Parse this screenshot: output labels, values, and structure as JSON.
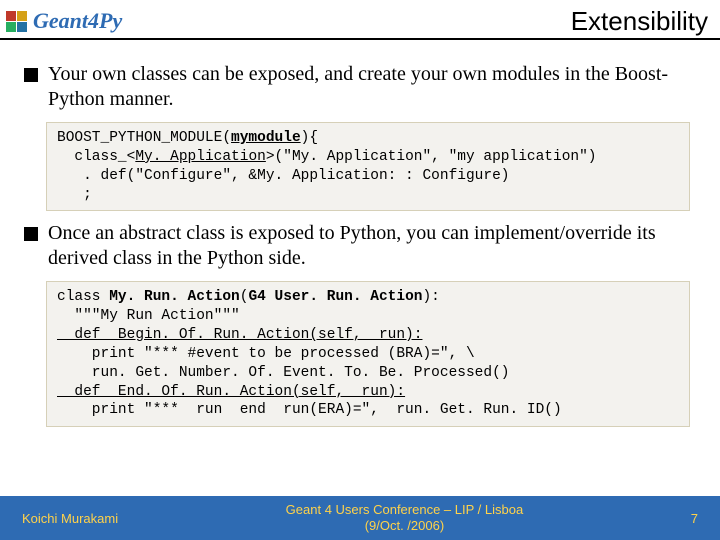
{
  "brand": "Geant4Py",
  "title": "Extensibility",
  "bullets": [
    "Your own classes can be exposed, and create your own modules in the Boost-Python manner.",
    "Once an abstract class is exposed to Python, you can implement/override its derived class in the Python side."
  ],
  "code1": {
    "l1a": "BOOST_PYTHON_MODULE(",
    "l1b": "mymodule",
    "l1c": "){",
    "l2a": "  class_<",
    "l2b": "My. Application",
    "l2c": ">(\"My. Application\", \"my application\")",
    "l3": "   . def(\"Configure\", &My. Application: : Configure)",
    "l4": "   ;"
  },
  "code2": {
    "l1a": "class ",
    "l1b": "My. Run. Action",
    "l1c": "(",
    "l1d": "G4 User. Run. Action",
    "l1e": "):",
    "l2": "  \"\"\"My Run Action\"\"\"",
    "l3": "  def  Begin. Of. Run. Action(self,  run):",
    "l4": "    print \"*** #event to be processed (BRA)=\", \\",
    "l5": "    run. Get. Number. Of. Event. To. Be. Processed()",
    "l6": "  def  End. Of. Run. Action(self,  run):",
    "l7": "    print \"***  run  end  run(ERA)=\",  run. Get. Run. ID()"
  },
  "footer": {
    "left": "Koichi Murakami",
    "center1": "Geant 4 Users Conference – LIP / Lisboa",
    "center2": "(9/Oct. /2006)",
    "right": "7"
  }
}
